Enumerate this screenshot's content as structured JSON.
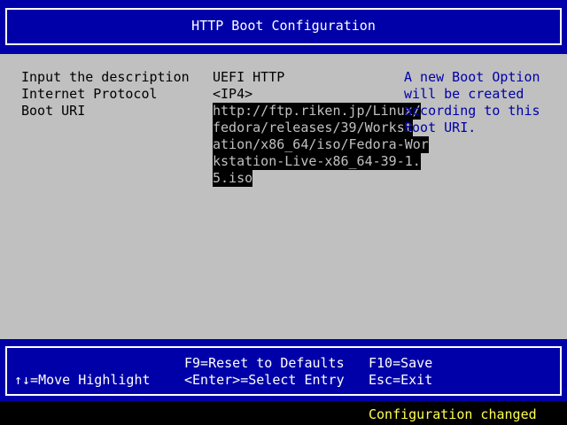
{
  "header": {
    "title": "HTTP Boot Configuration"
  },
  "form": {
    "description": {
      "label": "Input the description",
      "value": "UEFI HTTP"
    },
    "protocol": {
      "label": "Internet Protocol",
      "value": "<IP4>"
    },
    "uri": {
      "label": "Boot URI",
      "lines": [
        "http://ftp.riken.jp/Linux/",
        "fedora/releases/39/Workst",
        "ation/x86_64/iso/Fedora-Wor",
        "kstation-Live-x86_64-39-1.",
        "5.iso"
      ]
    }
  },
  "help": {
    "lines": [
      "A new Boot Option",
      "will be created",
      "according to this",
      "Boot URI."
    ]
  },
  "footer": {
    "move": "↑↓=Move Highlight",
    "reset": "F9=Reset to Defaults",
    "select": "<Enter>=Select Entry",
    "save": "F10=Save",
    "exit": "Esc=Exit"
  },
  "status": {
    "text": "Configuration changed"
  },
  "colors": {
    "frame_blue": "#0000a8",
    "body_gray": "#c0c0c0",
    "help_blue": "#0000a8",
    "status_yellow": "#ffff54"
  }
}
